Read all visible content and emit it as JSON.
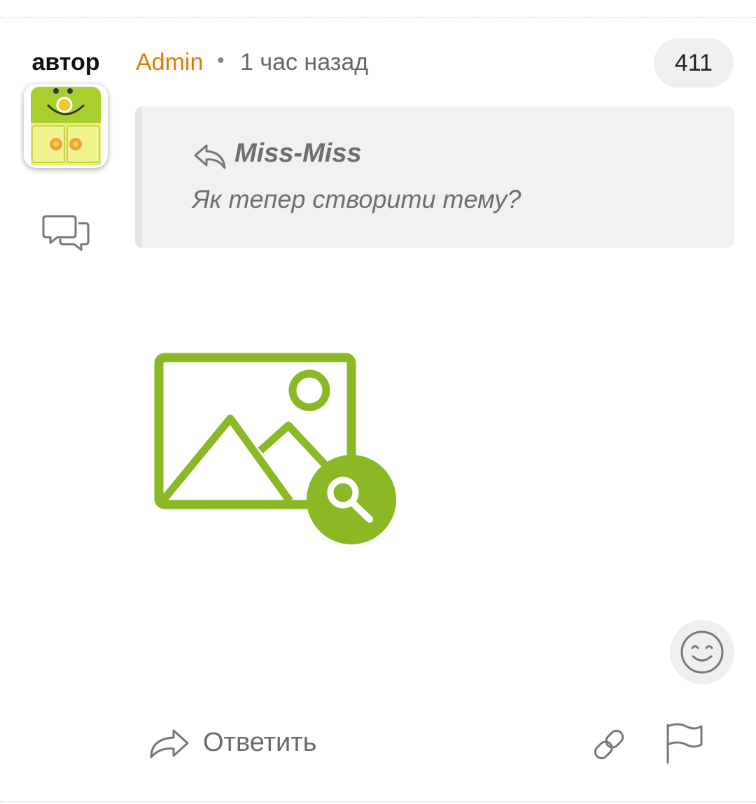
{
  "author_badge": "автор",
  "post": {
    "author": "Admin",
    "separator": "•",
    "time": "1 час назад",
    "number": "411"
  },
  "quote": {
    "author": "Miss-Miss",
    "text": "Як тепер створити тему?"
  },
  "actions": {
    "reply_label": "Ответить"
  },
  "colors": {
    "author_name": "#e07b00",
    "image_placeholder": "#8ab925",
    "quote_background": "#f1f1f1"
  },
  "icons": {
    "chat": "chat-bubbles-icon",
    "quote_reply": "reply-arrow-icon",
    "image": "image-search-icon",
    "emoji": "smiley-icon",
    "reply": "reply-forward-icon",
    "link": "link-icon",
    "flag": "flag-icon"
  }
}
